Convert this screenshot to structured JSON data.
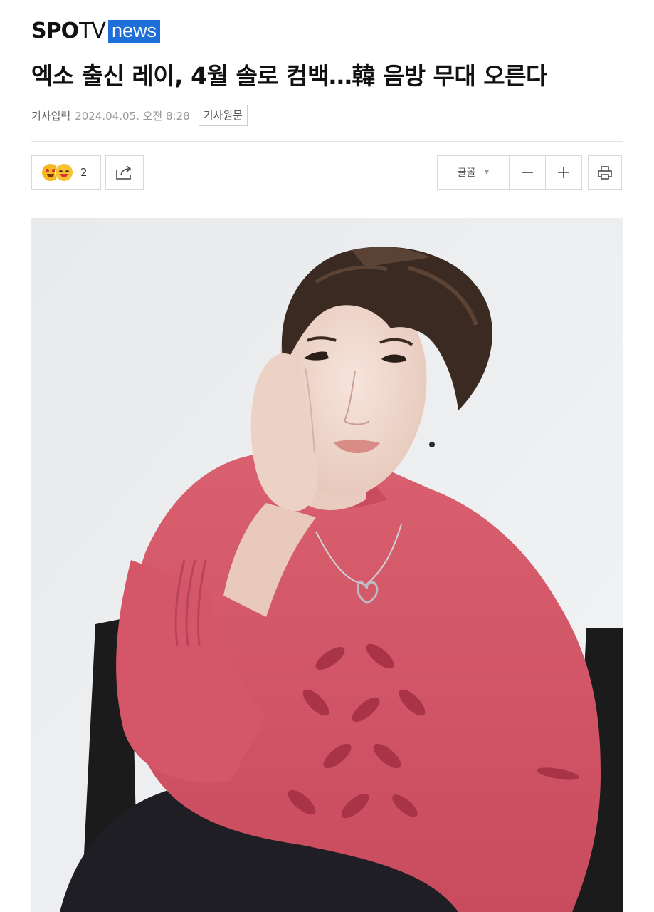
{
  "brand": {
    "part1": "SPO",
    "part2": "TV",
    "part3": "news",
    "accent": "#1e6fd9"
  },
  "article": {
    "headline": "엑소 출신 레이, 4월 솔로 컴백…韓 음방 무대 오른다",
    "input_label": "기사입력",
    "date": "2024.04.05. 오전 8:28",
    "original_button": "기사원문"
  },
  "toolbar": {
    "reaction_icon": "smiling-emoji-icon",
    "reaction_count": "2",
    "share_icon": "share-icon",
    "font_label": "글꼴",
    "font_caret": "▼",
    "minus_icon": "minus-icon",
    "plus_icon": "plus-icon",
    "print_icon": "print-icon"
  },
  "photo": {
    "description_colors": {
      "background": "#eceef0",
      "sweater": "#d4576b",
      "hair": "#3a2a22",
      "chair": "#1a1a1a"
    }
  }
}
